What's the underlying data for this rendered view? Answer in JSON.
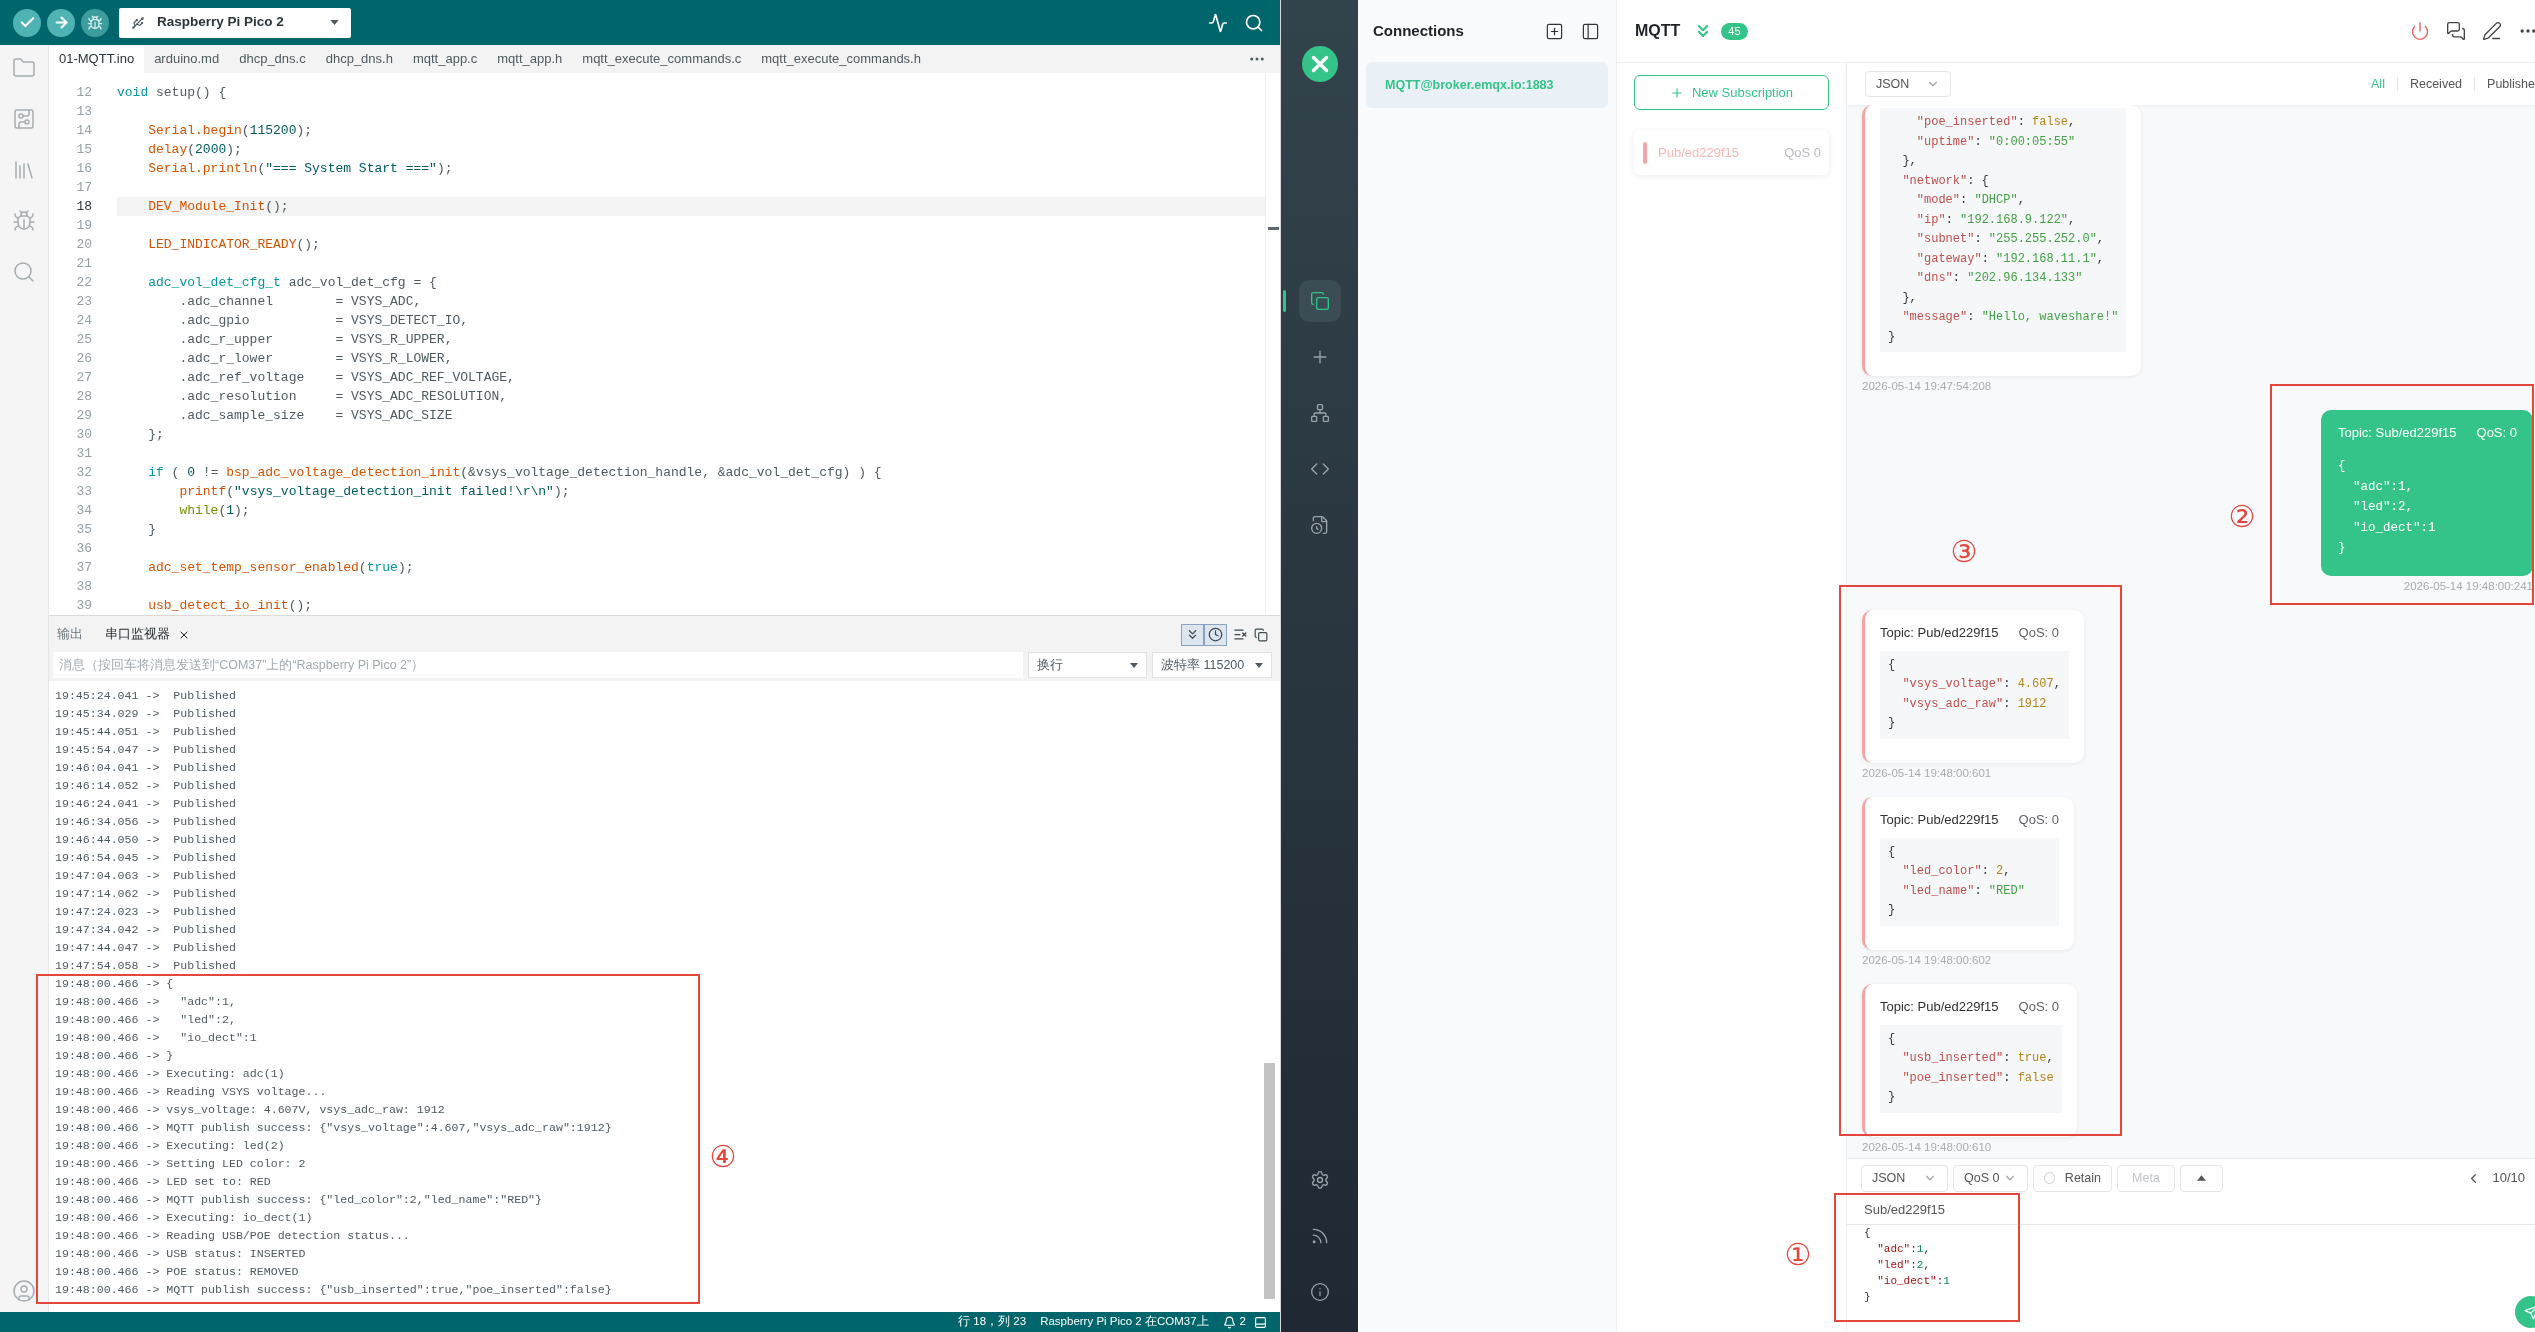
{
  "arduino_ide": {
    "toolbar": {
      "board": "Raspberry Pi Pico 2"
    },
    "file_tabs": [
      {
        "label": "01-MQTT.ino",
        "selected": true
      },
      {
        "label": "arduino.md",
        "selected": false
      },
      {
        "label": "dhcp_dns.c",
        "selected": false
      },
      {
        "label": "dhcp_dns.h",
        "selected": false
      },
      {
        "label": "mqtt_app.c",
        "selected": false
      },
      {
        "label": "mqtt_app.h",
        "selected": false
      },
      {
        "label": "mqtt_execute_commands.c",
        "selected": false
      },
      {
        "label": "mqtt_execute_commands.h",
        "selected": false
      }
    ],
    "editor": {
      "lines": [
        {
          "number": "12",
          "current": false,
          "tokens": [
            {
              "kind": "keyword",
              "text": "void"
            },
            {
              "kind": "plain",
              "text": " setup() {"
            }
          ]
        },
        {
          "number": "13",
          "current": false
        },
        {
          "number": "14",
          "current": false,
          "tokens": [
            {
              "kind": "function",
              "text": "    Serial.begin"
            },
            {
              "kind": "plain",
              "text": "("
            },
            {
              "kind": "number",
              "text": "115200"
            },
            {
              "kind": "plain",
              "text": ");"
            }
          ]
        },
        {
          "number": "15",
          "current": false,
          "tokens": [
            {
              "kind": "function",
              "text": "    delay"
            },
            {
              "kind": "plain",
              "text": "("
            },
            {
              "kind": "number",
              "text": "2000"
            },
            {
              "kind": "plain",
              "text": ");"
            }
          ]
        },
        {
          "number": "16",
          "current": false,
          "tokens": [
            {
              "kind": "function",
              "text": "    Serial.println"
            },
            {
              "kind": "plain",
              "text": "("
            },
            {
              "kind": "string",
              "text": "\"=== System Start ===\""
            },
            {
              "kind": "plain",
              "text": ");"
            }
          ]
        },
        {
          "number": "17",
          "current": false
        },
        {
          "number": "18",
          "current": true,
          "tokens": [
            {
              "kind": "function",
              "text": "    DEV_Module_Init"
            },
            {
              "kind": "plain",
              "text": "();"
            }
          ]
        },
        {
          "number": "19",
          "current": false
        },
        {
          "number": "20",
          "current": false,
          "tokens": [
            {
              "kind": "function",
              "text": "    LED_INDICATOR_READY"
            },
            {
              "kind": "plain",
              "text": "();"
            }
          ]
        },
        {
          "number": "21",
          "current": false
        },
        {
          "number": "22",
          "current": false,
          "tokens": [
            {
              "kind": "keyword",
              "text": "    adc_vol_det_cfg_t"
            },
            {
              "kind": "plain",
              "text": " adc_vol_det_cfg = {"
            }
          ]
        },
        {
          "number": "23",
          "current": false,
          "tokens": [
            {
              "kind": "plain",
              "text": "        .adc_channel        = VSYS_ADC,"
            }
          ]
        },
        {
          "number": "24",
          "current": false,
          "tokens": [
            {
              "kind": "plain",
              "text": "        .adc_gpio           = VSYS_DETECT_IO,"
            }
          ]
        },
        {
          "number": "25",
          "current": false,
          "tokens": [
            {
              "kind": "plain",
              "text": "        .adc_r_upper        = VSYS_R_UPPER,"
            }
          ]
        },
        {
          "number": "26",
          "current": false,
          "tokens": [
            {
              "kind": "plain",
              "text": "        .adc_r_lower        = VSYS_R_LOWER,"
            }
          ]
        },
        {
          "number": "27",
          "current": false,
          "tokens": [
            {
              "kind": "plain",
              "text": "        .adc_ref_voltage    = VSYS_ADC_REF_VOLTAGE,"
            }
          ]
        },
        {
          "number": "28",
          "current": false,
          "tokens": [
            {
              "kind": "plain",
              "text": "        .adc_resolution     = VSYS_ADC_RESOLUTION,"
            }
          ]
        },
        {
          "number": "29",
          "current": false,
          "tokens": [
            {
              "kind": "plain",
              "text": "        .adc_sample_size    = VSYS_ADC_SIZE"
            }
          ]
        },
        {
          "number": "30",
          "current": false,
          "tokens": [
            {
              "kind": "plain",
              "text": "    };"
            }
          ]
        },
        {
          "number": "31",
          "current": false
        },
        {
          "number": "32",
          "current": false,
          "tokens": [
            {
              "kind": "keyword",
              "text": "    if"
            },
            {
              "kind": "plain",
              "text": " ( "
            },
            {
              "kind": "number",
              "text": "0"
            },
            {
              "kind": "plain",
              "text": " != "
            },
            {
              "kind": "function",
              "text": "bsp_adc_voltage_detection_init"
            },
            {
              "kind": "plain",
              "text": "(&vsys_voltage_detection_handle, &adc_vol_det_cfg) ) {"
            }
          ]
        },
        {
          "number": "33",
          "current": false,
          "tokens": [
            {
              "kind": "function",
              "text": "        printf"
            },
            {
              "kind": "plain",
              "text": "("
            },
            {
              "kind": "string",
              "text": "\"vsys_voltage_detection_init failed!\\r\\n\""
            },
            {
              "kind": "plain",
              "text": ");"
            }
          ]
        },
        {
          "number": "34",
          "current": false,
          "tokens": [
            {
              "kind": "control",
              "text": "        while"
            },
            {
              "kind": "plain",
              "text": "("
            },
            {
              "kind": "number",
              "text": "1"
            },
            {
              "kind": "plain",
              "text": ");"
            }
          ]
        },
        {
          "number": "35",
          "current": false,
          "tokens": [
            {
              "kind": "plain",
              "text": "    }"
            }
          ]
        },
        {
          "number": "36",
          "current": false
        },
        {
          "number": "37",
          "current": false,
          "tokens": [
            {
              "kind": "function",
              "text": "    adc_set_temp_sensor_enabled"
            },
            {
              "kind": "plain",
              "text": "("
            },
            {
              "kind": "keyword",
              "text": "true"
            },
            {
              "kind": "plain",
              "text": ");"
            }
          ]
        },
        {
          "number": "38",
          "current": false
        },
        {
          "number": "39",
          "current": false,
          "tokens": [
            {
              "kind": "function",
              "text": "    usb_detect_io_init"
            },
            {
              "kind": "plain",
              "text": "();"
            }
          ]
        }
      ]
    },
    "output_panel": {
      "tabs": [
        {
          "label": "输出",
          "selected": false
        },
        {
          "label": "串口监视器",
          "selected": true
        }
      ],
      "toggles": [
        {
          "kind": "autoscroll",
          "on": true
        },
        {
          "kind": "timestamp",
          "on": true
        }
      ],
      "message_input": {
        "placeholder": "消息（按回车将消息发送到“COM37”上的“Raspberry Pi Pico 2”）"
      },
      "line_ending": "换行",
      "baud_rate": "波特率 115200",
      "log": [
        "19:45:24.041 ->  Published",
        "19:45:34.029 ->  Published",
        "19:45:44.051 ->  Published",
        "19:45:54.047 ->  Published",
        "19:46:04.041 ->  Published",
        "19:46:14.052 ->  Published",
        "19:46:24.041 ->  Published",
        "19:46:34.056 ->  Published",
        "19:46:44.050 ->  Published",
        "19:46:54.045 ->  Published",
        "19:47:04.063 ->  Published",
        "19:47:14.062 ->  Published",
        "19:47:24.023 ->  Published",
        "19:47:34.042 ->  Published",
        "19:47:44.047 ->  Published",
        "19:47:54.058 ->  Published",
        "19:48:00.466 -> {",
        "19:48:00.466 ->   \"adc\":1,",
        "19:48:00.466 ->   \"led\":2,",
        "19:48:00.466 ->   \"io_dect\":1",
        "19:48:00.466 -> }",
        "19:48:00.466 -> Executing: adc(1)",
        "19:48:00.466 -> Reading VSYS voltage...",
        "19:48:00.466 -> vsys_voltage: 4.607V, vsys_adc_raw: 1912",
        "19:48:00.466 -> MQTT publish success: {\"vsys_voltage\":4.607,\"vsys_adc_raw\":1912}",
        "19:48:00.466 -> Executing: led(2)",
        "19:48:00.466 -> Setting LED color: 2",
        "19:48:00.466 -> LED set to: RED",
        "19:48:00.466 -> MQTT publish success: {\"led_color\":2,\"led_name\":\"RED\"}",
        "19:48:00.466 -> Executing: io_dect(1)",
        "19:48:00.466 -> Reading USB/POE detection status...",
        "19:48:00.466 -> USB status: INSERTED",
        "19:48:00.466 -> POE status: REMOVED",
        "19:48:00.466 -> MQTT publish success: {\"usb_inserted\":true,\"poe_inserted\":false}"
      ]
    },
    "status_bar": {
      "position": "行 18，列 23",
      "board_port": "Raspberry Pi Pico 2 在COM37上",
      "notifications": "2"
    }
  },
  "mqttx": {
    "nav": [
      {
        "kind": "connections",
        "selected": true
      },
      {
        "kind": "new_connection",
        "selected": false
      },
      {
        "kind": "topology",
        "selected": false
      },
      {
        "kind": "script",
        "selected": false
      },
      {
        "kind": "log",
        "selected": false
      }
    ],
    "nav_bottom": [
      {
        "kind": "settings",
        "selected": false
      },
      {
        "kind": "feed",
        "selected": false
      },
      {
        "kind": "about",
        "selected": false
      }
    ],
    "connections_panel": {
      "title": "Connections",
      "items": [
        {
          "name": "MQTT@broker.emqx.io:1883",
          "selected": true
        }
      ]
    },
    "connection": {
      "name": "MQTT",
      "unread": "45",
      "new_subscription": "New Subscription",
      "subscriptions": [
        {
          "topic": "Pub/ed229f15",
          "qos": "QoS 0",
          "color": "#f4a4a2"
        }
      ],
      "format": "JSON",
      "filters": [
        {
          "label": "All",
          "selected": true
        },
        {
          "label": "Received",
          "selected": false
        },
        {
          "label": "Publishe",
          "selected": false
        }
      ],
      "messages": [
        {
          "kind": "received",
          "payload": [
            "    \"poe_inserted\": false,",
            "    \"uptime\": \"0:00:05:55\"",
            "  },",
            "  \"network\": {",
            "    \"mode\": \"DHCP\",",
            "    \"ip\": \"192.168.9.122\",",
            "    \"subnet\": \"255.255.252.0\",",
            "    \"gateway\": \"192.168.11.1\",",
            "    \"dns\": \"202.96.134.133\"",
            "  },",
            "  \"message\": \"Hello, waveshare!\"",
            "}"
          ],
          "time": "2026-05-14 19:47:54:208"
        },
        {
          "kind": "sent",
          "topic": "Topic: Sub/ed229f15",
          "qos": "QoS: 0",
          "payload": [
            "{",
            "  \"adc\":1,",
            "  \"led\":2,",
            "  \"io_dect\":1",
            "}"
          ],
          "time": "2026-05-14 19:48:00:241"
        },
        {
          "kind": "received",
          "topic": "Topic: Pub/ed229f15",
          "qos": "QoS: 0",
          "payload": [
            "{",
            "  \"vsys_voltage\": 4.607,",
            "  \"vsys_adc_raw\": 1912",
            "}"
          ],
          "time": "2026-05-14 19:48:00:601"
        },
        {
          "kind": "received",
          "topic": "Topic: Pub/ed229f15",
          "qos": "QoS: 0",
          "payload": [
            "{",
            "  \"led_color\": 2,",
            "  \"led_name\": \"RED\"",
            "}"
          ],
          "time": "2026-05-14 19:48:00:602"
        },
        {
          "kind": "received",
          "topic": "Topic: Pub/ed229f15",
          "qos": "QoS: 0",
          "payload": [
            "{",
            "  \"usb_inserted\": true,",
            "  \"poe_inserted\": false",
            "}"
          ],
          "time": "2026-05-14 19:48:00:610"
        }
      ],
      "publish": {
        "format": "JSON",
        "qos": "QoS 0",
        "retain": {
          "label": "Retain",
          "checked": false
        },
        "meta": {
          "label": "Meta",
          "disabled": true
        },
        "page": "10/10",
        "topic": "Sub/ed229f15",
        "payload": [
          "{",
          "  \"adc\":1,",
          "  \"led\":2,",
          "  \"io_dect\":1",
          "}"
        ]
      }
    }
  },
  "annotations": [
    {
      "label": "①"
    },
    {
      "label": "②"
    },
    {
      "label": "③"
    },
    {
      "label": "④"
    }
  ]
}
